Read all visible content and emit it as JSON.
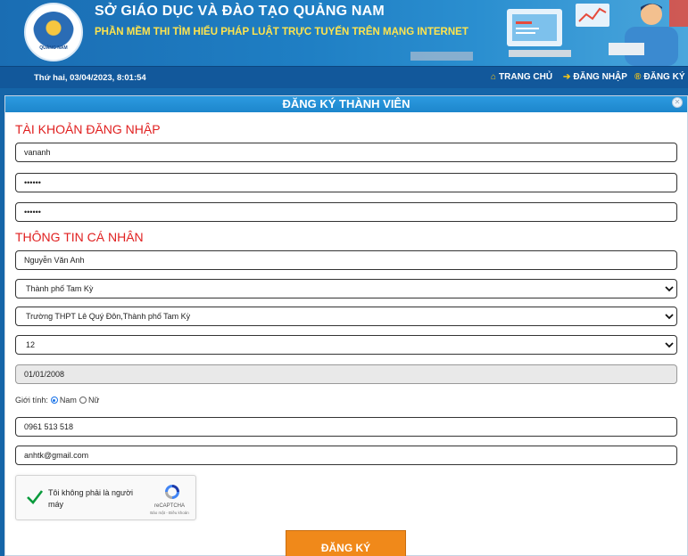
{
  "header": {
    "title": "SỞ GIÁO DỤC VÀ ĐÀO TẠO QUẢNG NAM",
    "subtitle": "PHẦN MỀM THI TÌM HIỂU PHÁP LUẬT TRỰC TUYẾN TRÊN MẠNG INTERNET",
    "logo_text": "QUẢNG NAM"
  },
  "nav": {
    "datetime": "Thứ hai, 03/04/2023, 8:01:54",
    "home": "TRANG CHỦ",
    "login": "ĐĂNG NHẬP",
    "register": "ĐĂNG KÝ"
  },
  "form": {
    "heading": "ĐĂNG KÝ THÀNH VIÊN",
    "account_section": "TÀI KHOẢN ĐĂNG NHẬP",
    "username": "vananh",
    "password": "••••••",
    "password_confirm": "••••••",
    "personal_section": "THÔNG TIN CÁ NHÂN",
    "full_name": "Nguyễn Văn Anh",
    "district": "Thành phố Tam Kỳ",
    "school": "Trường THPT Lê Quý Đôn,Thành phố Tam Kỳ",
    "grade": "12",
    "birthdate": "01/01/2008",
    "gender_label": "Giới tính:",
    "gender_male": "Nam",
    "gender_female": "Nữ",
    "gender_selected": "Nam",
    "phone": "0961 513 518",
    "email": "anhtk@gmail.com",
    "submit": "ĐĂNG KÝ"
  },
  "captcha": {
    "label": "Tôi không phải là người máy",
    "brand": "reCAPTCHA",
    "terms": "Bảo mật - Điều khoản"
  },
  "colors": {
    "header_blue": "#1f7fc4",
    "navbar_blue": "#12589b",
    "panel_head": "#2c9be0",
    "section_red": "#e02020",
    "subtitle_yellow": "#ffe44d",
    "submit_orange": "#f0891a"
  }
}
